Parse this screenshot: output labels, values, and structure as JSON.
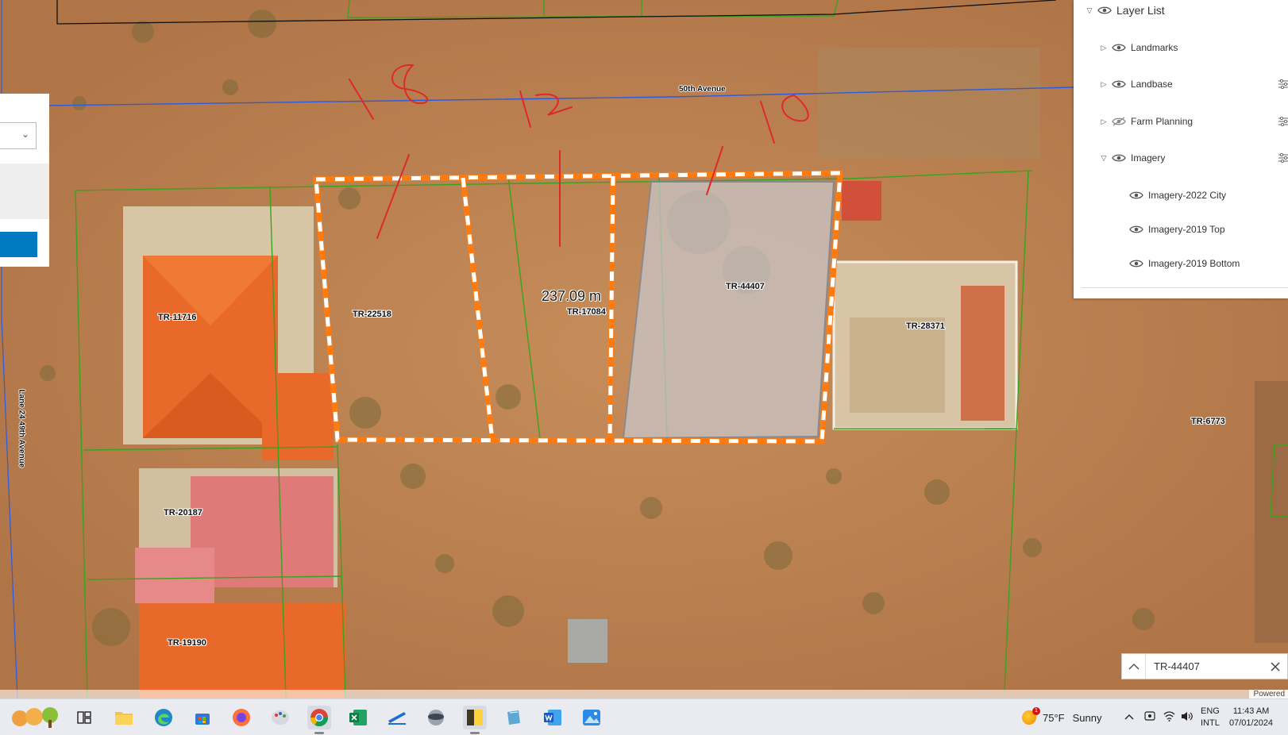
{
  "map": {
    "street_top": "50th Avenue",
    "street_side": "Lane 24 49th Avenue",
    "measurement": "237.09 m",
    "parcels": [
      "TR-22518",
      "TR-17084",
      "TR-44407",
      "TR-11716",
      "TR-28371",
      "TR-6773",
      "TR-20187",
      "TR-19190"
    ],
    "colors": {
      "parcel_line": "#3aa21f",
      "road_line": "#2d5bdc",
      "selection_dash": "#ff7b10",
      "annotation": "#e0282a"
    }
  },
  "layer_list": {
    "title": "Layer List",
    "layers": [
      {
        "label": "Landmarks"
      },
      {
        "label": "Landbase"
      },
      {
        "label": "Farm Planning"
      },
      {
        "label": "Imagery"
      }
    ],
    "sublayers": [
      {
        "label": "Imagery-2022 City"
      },
      {
        "label": "Imagery-2019 Top"
      },
      {
        "label": "Imagery-2019 Bottom"
      }
    ]
  },
  "search": {
    "value": "TR-44407"
  },
  "attribution": "Powered",
  "taskbar": {
    "weather_temp": "75°F",
    "weather_cond": "Sunny",
    "weather_badge": "1",
    "lang_top": "ENG",
    "lang_bottom": "INTL",
    "time": "11:43 AM",
    "date": "07/01/2024",
    "apps": [
      "widgets",
      "task-view",
      "file-explorer",
      "edge",
      "store",
      "firefox",
      "paint",
      "chrome",
      "excel",
      "pen-tool",
      "mydisk",
      "sticky-notes",
      "notebook",
      "word",
      "photos"
    ]
  }
}
